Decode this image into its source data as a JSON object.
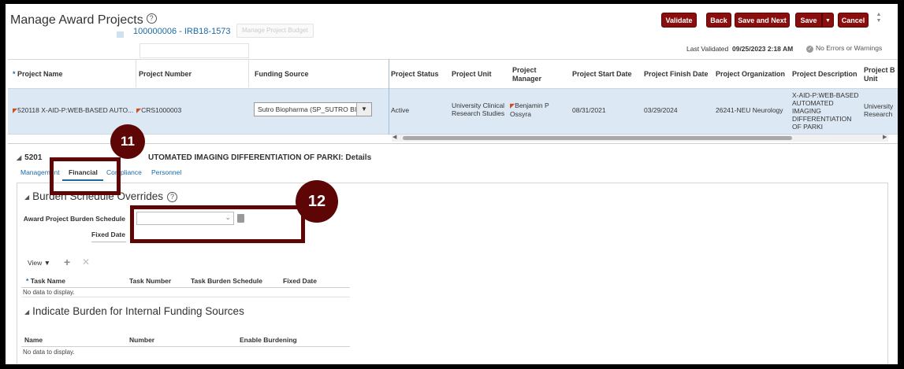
{
  "header": {
    "title": "Manage Award Projects",
    "help_glyph": "?",
    "project_link": "100000006 - IRB18-1573",
    "ghost_button": "Manage Project Budget",
    "last_validated_label": "Last Validated",
    "last_validated_value": "09/25/2023 2:18 AM",
    "status": "No Errors or Warnings"
  },
  "toolbar": {
    "validate": "Validate",
    "back": "Back",
    "save_and_next": "Save and Next",
    "save": "Save",
    "dropdown_glyph": "▼",
    "cancel": "Cancel"
  },
  "grid": {
    "columns": {
      "project_name": "Project Name",
      "project_number": "Project Number",
      "funding_source": "Funding Source",
      "project_status": "Project Status",
      "project_unit": "Project Unit",
      "project_manager_1": "Project",
      "project_manager_2": "Manager",
      "start_date": "Project Start Date",
      "finish_date": "Project Finish Date",
      "organization": "Project Organization",
      "description": "Project Description",
      "bu_1": "Project B",
      "bu_2": "Unit"
    },
    "row": {
      "project_name": "520118 X-AID-P:WEB-BASED AUTO...",
      "project_number": "CRS1000003",
      "funding_source": "Sutro Biopharma (SP_SUTRO BIO",
      "status": "Active",
      "unit_1": "University Clinical",
      "unit_2": "Research Studies",
      "manager_1": "Benjamin P",
      "manager_2": "Ossyra",
      "start_date": "08/31/2021",
      "finish_date": "03/29/2024",
      "organization": "26241-NEU Neurology",
      "desc_1": "X-AID-P:WEB-BASED",
      "desc_2": "AUTOMATED",
      "desc_3": "IMAGING",
      "desc_4": "DIFFERENTIATION",
      "desc_5": "OF PARKI",
      "bu_1": "University",
      "bu_2": "Research"
    }
  },
  "details": {
    "title_prefix": "5201",
    "title_suffix": "UTOMATED IMAGING DIFFERENTIATION OF PARKI: Details",
    "tabs": {
      "management": "Management",
      "financial": "Financial",
      "compliance": "Compliance",
      "personnel": "Personnel"
    }
  },
  "burden": {
    "title": "Burden Schedule Overrides",
    "schedule_label": "Award Project Burden Schedule",
    "fixed_date_label": "Fixed Date",
    "view_menu": "View ▼",
    "columns": {
      "task_name": "Task Name",
      "task_number": "Task Number",
      "task_burden_schedule": "Task Burden Schedule",
      "fixed_date": "Fixed Date"
    },
    "no_data": "No data to display."
  },
  "internal": {
    "title": "Indicate Burden for Internal Funding Sources",
    "columns": {
      "name": "Name",
      "number": "Number",
      "enable": "Enable Burdening"
    },
    "no_data": "No data to display."
  },
  "callouts": {
    "c11": "11",
    "c12": "12"
  },
  "colors": {
    "accent": "#8a0e0e",
    "callout": "#5e0606",
    "link": "#1a6aa5",
    "selected_row": "#dce9f5"
  }
}
